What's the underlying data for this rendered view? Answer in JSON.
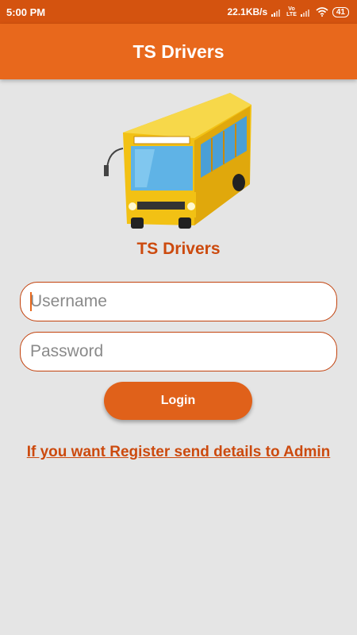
{
  "status_bar": {
    "time": "5:00 PM",
    "speed": "22.1KB/s",
    "volte_top": "Vo",
    "volte_bottom": "LTE",
    "battery": "41"
  },
  "app_bar": {
    "title": "TS Drivers"
  },
  "brand": {
    "title": "TS Drivers",
    "logo_icon": "bus-icon"
  },
  "form": {
    "username_placeholder": "Username",
    "password_placeholder": "Password",
    "login_label": "Login",
    "register_text": "If you want Register send details to Admin"
  },
  "colors": {
    "status_bar": "#d4530f",
    "app_bar": "#e8681c",
    "accent": "#cc4a0e",
    "background": "#e5e5e5"
  }
}
